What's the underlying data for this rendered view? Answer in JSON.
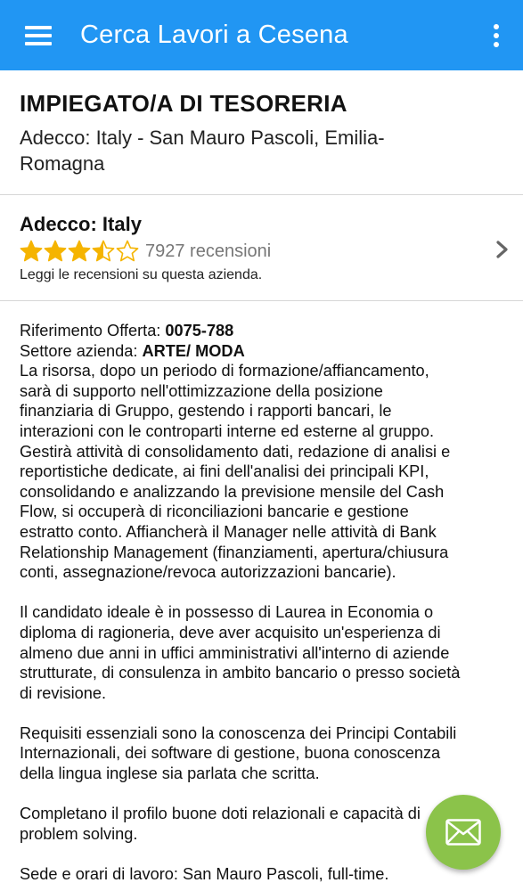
{
  "appbar": {
    "title": "Cerca Lavori a Cesena",
    "menu_icon": "hamburger-menu-icon",
    "overflow_icon": "more-vert-icon",
    "color": "#2196f3"
  },
  "job": {
    "title": "IMPIEGATO/A DI TESORERIA",
    "company_location": "Adecco: Italy - San Mauro Pascoli, Emilia-Romagna"
  },
  "company": {
    "name": "Adecco: Italy",
    "rating": 3.5,
    "rating_max": 5,
    "reviews": "7927 recensioni",
    "reviews_link": "Leggi le recensioni su questa azienda.",
    "star_color": "#f5b400"
  },
  "description": {
    "ref_label": "Riferimento Offerta: ",
    "ref_value": "0075-788",
    "sector_label": "Settore azienda: ",
    "sector_value": "ARTE/ MODA",
    "paragraphs": [
      "La risorsa, dopo un periodo di formazione/affiancamento,\nsarà di supporto nell'ottimizzazione della posizione\nfinanziaria di Gruppo, gestendo i rapporti bancari, le\ninterazioni con le controparti interne ed esterne al gruppo.\nGestirà attività di consolidamento dati, redazione di analisi e\nreportistiche dedicate, ai fini dell'analisi dei principali KPI,\nconsolidando e analizzando la previsione mensile del Cash\nFlow, si occuperà di riconciliazioni bancarie e gestione\nestratto conto. Affiancherà il Manager nelle attività di Bank\nRelationship Management (finanziamenti, apertura/chiusura\nconti, assegnazione/revoca autorizzazioni bancarie).",
      "Il candidato ideale è in possesso di Laurea in Economia o\ndiploma di ragioneria, deve aver acquisito un'esperienza di\nalmeno due anni in uffici amministrativi all'interno di aziende\nstrutturate, di consulenza in ambito bancario o presso società\ndi revisione.",
      "Requisiti essenziali sono la conoscenza dei Principi Contabili\nInternazionali, dei software di gestione, buona conoscenza\ndella lingua inglese sia parlata che scritta.",
      "Completano il profilo buone doti relazionali e capacità di\nproblem solving.",
      "Sede e orari di lavoro: San Mauro Pascoli, full-time."
    ]
  },
  "fab": {
    "icon": "envelope-icon",
    "color": "#8bc34a"
  }
}
